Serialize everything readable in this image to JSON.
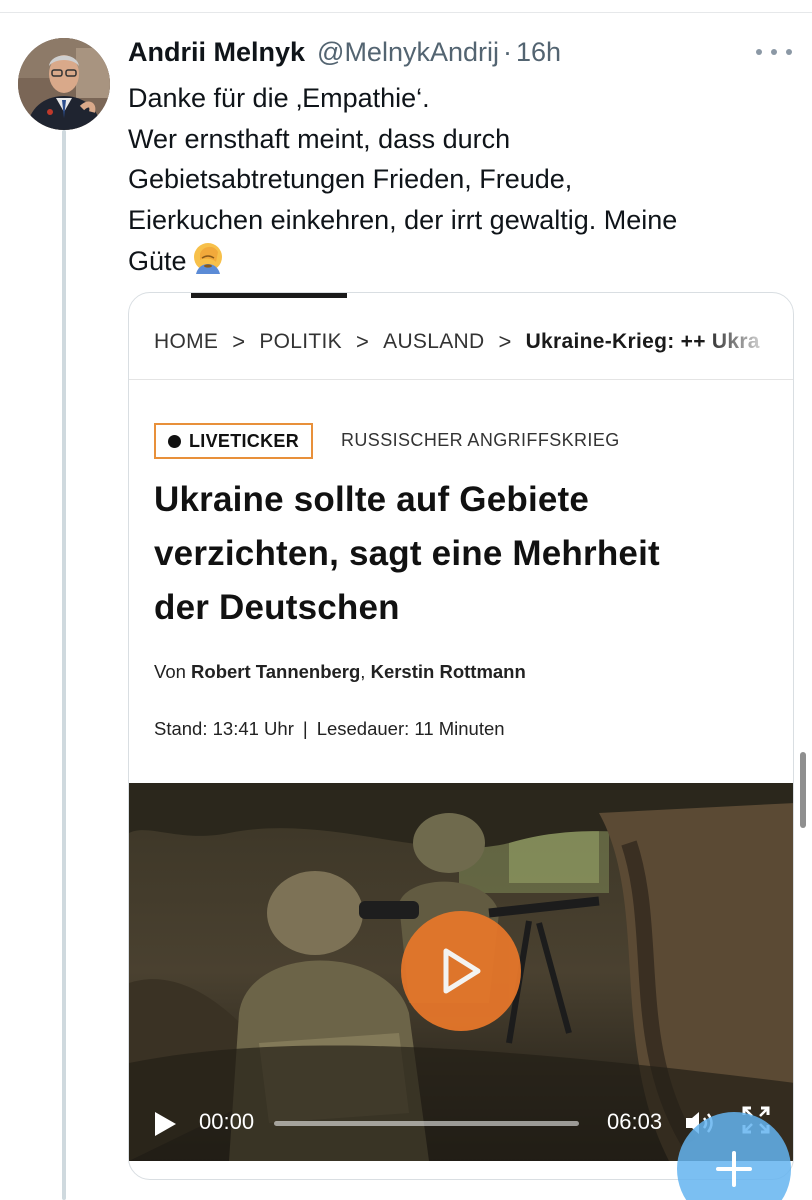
{
  "tweet": {
    "author_name": "Andrii Melnyk",
    "handle": "@MelnykAndrij",
    "separator": "·",
    "time": "16h",
    "text_lines": [
      "Danke für die ‚Empathie‘.",
      "Wer ernsthaft meint, dass durch",
      "Gebietsabtretungen Frieden, Freude,",
      "Eierkuchen einkehren, der irrt gewaltig. Meine",
      "Güte"
    ],
    "emoji_icon": "facepalm-emoji-icon"
  },
  "card": {
    "breadcrumb": {
      "items": [
        "HOME",
        "POLITIK",
        "AUSLAND"
      ],
      "current": "Ukraine-Krieg: ++ Ukra",
      "separator": ">"
    },
    "badge": "LIVETICKER",
    "kicker": "RUSSISCHER ANGRIFFSKRIEG",
    "headline_lines": [
      "Ukraine sollte auf Gebiete",
      "verzichten, sagt eine Mehrheit",
      "der Deutschen"
    ],
    "byline_prefix": "Von",
    "byline_author_1": "Robert Tannenberg",
    "byline_comma": ",",
    "byline_author_2": "Kerstin Rottmann",
    "stand": "Stand: 13:41 Uhr",
    "meta_sep": "|",
    "lesedauer": "Lesedauer: 11 Minuten",
    "video": {
      "current_time": "00:00",
      "total_time": "06:03",
      "progress_fraction": 0.0
    }
  },
  "colors": {
    "badge_border": "#e8903a",
    "play_button": "#e8772a",
    "fab": "#64b4f0",
    "thread_line": "#cfd9de"
  }
}
